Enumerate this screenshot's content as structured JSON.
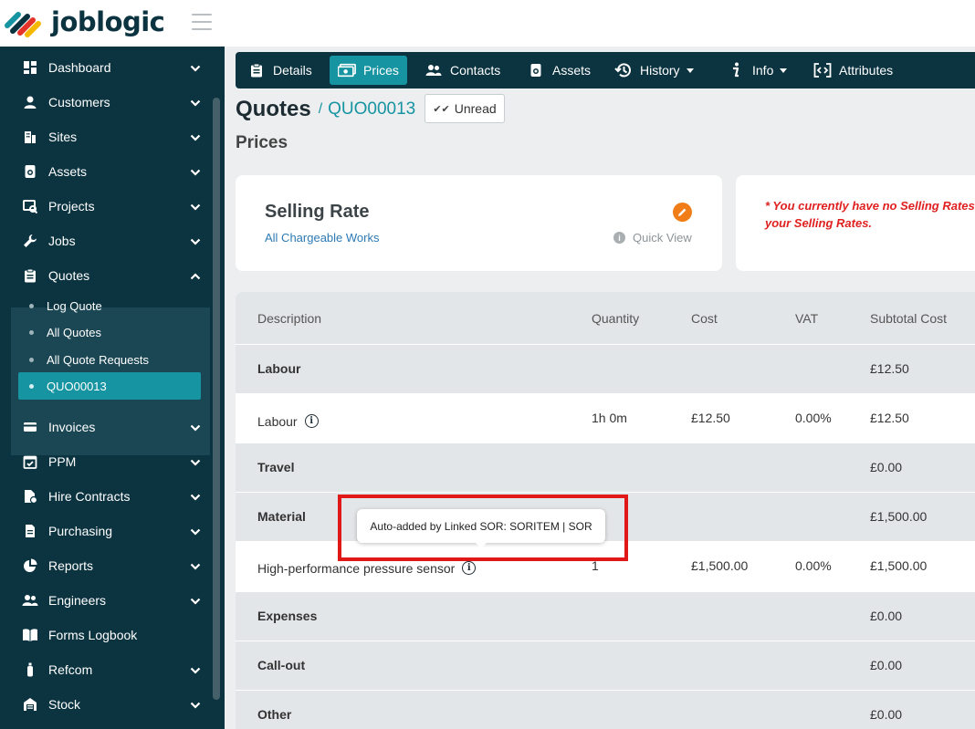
{
  "app": {
    "logo_text": "joblogic"
  },
  "sidebar": {
    "items": [
      {
        "label": "Dashboard",
        "icon": "dashboard-icon"
      },
      {
        "label": "Customers",
        "icon": "user-icon"
      },
      {
        "label": "Sites",
        "icon": "building-icon"
      },
      {
        "label": "Assets",
        "icon": "asset-icon"
      },
      {
        "label": "Projects",
        "icon": "project-icon"
      },
      {
        "label": "Jobs",
        "icon": "wrench-icon"
      },
      {
        "label": "Quotes",
        "icon": "clipboard-icon"
      },
      {
        "label": "Invoices",
        "icon": "invoice-icon"
      },
      {
        "label": "PPM",
        "icon": "calendar-check-icon"
      },
      {
        "label": "Hire Contracts",
        "icon": "hire-contract-icon"
      },
      {
        "label": "Purchasing",
        "icon": "document-icon"
      },
      {
        "label": "Reports",
        "icon": "pie-chart-icon"
      },
      {
        "label": "Engineers",
        "icon": "users-icon"
      },
      {
        "label": "Forms Logbook",
        "icon": "book-icon"
      },
      {
        "label": "Refcom",
        "icon": "cylinder-icon"
      },
      {
        "label": "Stock",
        "icon": "warehouse-icon"
      }
    ],
    "quotes_sub": [
      {
        "label": "Log Quote"
      },
      {
        "label": "All Quotes"
      },
      {
        "label": "All Quote Requests"
      },
      {
        "label": "QUO00013",
        "active": true
      }
    ]
  },
  "tabs": [
    {
      "label": "Details",
      "icon": "clipboard-icon"
    },
    {
      "label": "Prices",
      "icon": "money-icon",
      "active": true
    },
    {
      "label": "Contacts",
      "icon": "users-icon"
    },
    {
      "label": "Assets",
      "icon": "asset-icon"
    },
    {
      "label": "History",
      "icon": "history-icon",
      "dropdown": true
    },
    {
      "label": "Info",
      "icon": "info-icon",
      "dropdown": true
    },
    {
      "label": "Attributes",
      "icon": "attributes-icon"
    }
  ],
  "header": {
    "title": "Quotes",
    "separator": "/",
    "quote_id": "QUO00013",
    "unread_label": "Unread",
    "section": "Prices"
  },
  "selling_rate": {
    "title": "Selling Rate",
    "subtitle": "All Chargeable Works",
    "quick_view": "Quick View"
  },
  "warning": {
    "line1": "* You currently have no Selling Rates co",
    "line2": "your Selling Rates."
  },
  "table": {
    "columns": [
      "Description",
      "Quantity",
      "Cost",
      "VAT",
      "Subtotal Cost"
    ],
    "rows": [
      {
        "type": "group",
        "description": "Labour",
        "quantity": "",
        "cost": "",
        "vat": "",
        "subtotal": "£12.50"
      },
      {
        "type": "item",
        "description": "Labour",
        "info": true,
        "quantity": "1h 0m",
        "cost": "£12.50",
        "vat": "0.00%",
        "subtotal": "£12.50"
      },
      {
        "type": "group",
        "description": "Travel",
        "quantity": "",
        "cost": "",
        "vat": "",
        "subtotal": "£0.00"
      },
      {
        "type": "group",
        "description": "Material",
        "quantity": "",
        "cost": "",
        "vat": "",
        "subtotal": "£1,500.00"
      },
      {
        "type": "item",
        "description": "High-performance pressure sensor",
        "info": true,
        "quantity": "1",
        "cost": "£1,500.00",
        "vat": "0.00%",
        "subtotal": "£1,500.00"
      },
      {
        "type": "group",
        "description": "Expenses",
        "quantity": "",
        "cost": "",
        "vat": "",
        "subtotal": "£0.00"
      },
      {
        "type": "group",
        "description": "Call-out",
        "quantity": "",
        "cost": "",
        "vat": "",
        "subtotal": "£0.00"
      },
      {
        "type": "group",
        "description": "Other",
        "quantity": "",
        "cost": "",
        "vat": "",
        "subtotal": "£0.00"
      }
    ]
  },
  "tooltip": {
    "text": "Auto-added by Linked SOR: SORITEM | SOR"
  },
  "colors": {
    "sidebar_bg": "#0b3340",
    "accent": "#1694a2",
    "edit_orange": "#f07d18",
    "warning_red": "#e02020",
    "highlight_red": "#e01818"
  }
}
